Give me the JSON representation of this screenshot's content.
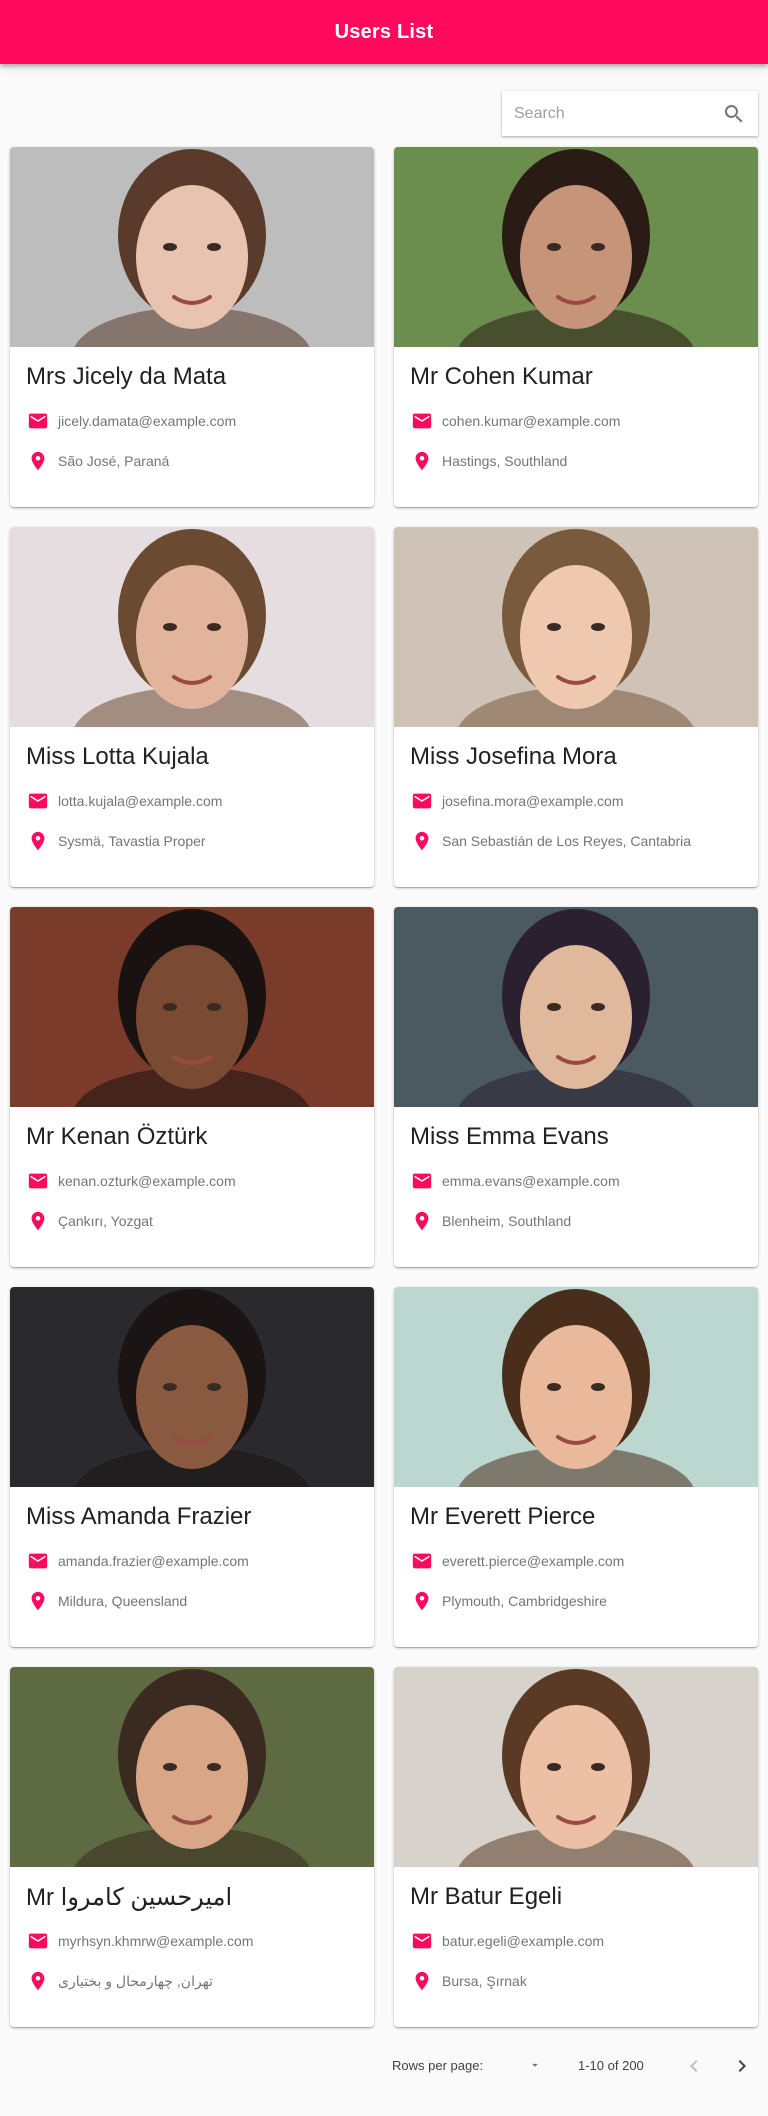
{
  "app": {
    "title": "Users List",
    "accent": "#ff0a5c"
  },
  "search": {
    "placeholder": "Search",
    "value": "",
    "icon": "search-icon"
  },
  "users": [
    {
      "name": "Mrs Jicely da Mata",
      "email": "jicely.damata@example.com",
      "location": "São José, Paraná",
      "photo_bg": "#bdbdbd",
      "skin": "#e8c3b0",
      "hair": "#5a3a2a"
    },
    {
      "name": "Mr Cohen Kumar",
      "email": "cohen.kumar@example.com",
      "location": "Hastings, Southland",
      "photo_bg": "#6b8e4e",
      "skin": "#c69478",
      "hair": "#2a1c14"
    },
    {
      "name": "Miss Lotta Kujala",
      "email": "lotta.kujala@example.com",
      "location": "Sysmä, Tavastia Proper",
      "photo_bg": "#e6dde0",
      "skin": "#e3b49c",
      "hair": "#6b4a32"
    },
    {
      "name": "Miss Josefina Mora",
      "email": "josefina.mora@example.com",
      "location": "San Sebastián de Los Reyes, Cantabria",
      "photo_bg": "#cfc3b8",
      "skin": "#efc8b0",
      "hair": "#7a5a3c"
    },
    {
      "name": "Mr Kenan Öztürk",
      "email": "kenan.ozturk@example.com",
      "location": "Çankırı, Yozgat",
      "photo_bg": "#7a3b2a",
      "skin": "#7a4a32",
      "hair": "#1a1210"
    },
    {
      "name": "Miss Emma Evans",
      "email": "emma.evans@example.com",
      "location": "Blenheim, Southland",
      "photo_bg": "#4a5a60",
      "skin": "#e0b89c",
      "hair": "#2a2030"
    },
    {
      "name": "Miss Amanda Frazier",
      "email": "amanda.frazier@example.com",
      "location": "Mildura, Queensland",
      "photo_bg": "#2a2a2e",
      "skin": "#8a5a40",
      "hair": "#1a1414"
    },
    {
      "name": "Mr Everett Pierce",
      "email": "everett.pierce@example.com",
      "location": "Plymouth, Cambridgeshire",
      "photo_bg": "#bcd6d0",
      "skin": "#eab89a",
      "hair": "#4a2e1c"
    },
    {
      "name": "Mr امیرحسین کامروا",
      "email": "myrhsyn.khmrw@example.com",
      "location": "تهران, چهارمحال و بختیاری",
      "photo_bg": "#5e6a42",
      "skin": "#d9a788",
      "hair": "#3a2a20"
    },
    {
      "name": "Mr Batur Egeli",
      "email": "batur.egeli@example.com",
      "location": "Bursa, Şırnak",
      "photo_bg": "#d8d2cc",
      "skin": "#ecc0a4",
      "hair": "#5a3a24"
    }
  ],
  "pagination": {
    "rows_per_page_label": "Rows per page:",
    "range": "1-10 of 200"
  }
}
